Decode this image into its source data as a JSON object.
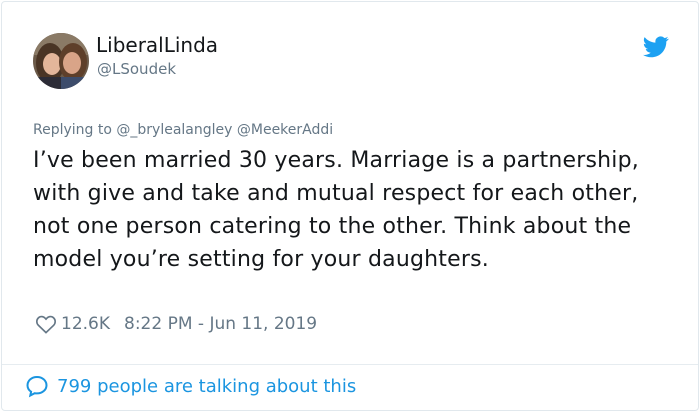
{
  "tweet": {
    "author": {
      "display_name": "LiberalLinda",
      "handle": "@LSoudek",
      "avatar_icon": "profile-photo"
    },
    "reply_to": {
      "prefix": "Replying to",
      "mentions": [
        "@_brylealangley",
        "@MeekerAddi"
      ]
    },
    "text": "I’ve been married 30 years. Marriage is a partnership, with give and take and mutual respect for each other, not one person catering to the other. Think about the model you’re setting for your daughters.",
    "likes": "12.6K",
    "timestamp": "8:22 PM - Jun 11, 2019",
    "conversation_label": "799 people are talking about this",
    "icons": {
      "brand": "twitter-bird-icon",
      "like": "heart-icon",
      "conversation": "speech-bubble-icon"
    },
    "colors": {
      "brand_blue": "#1da1f2",
      "link_blue": "#1b95e0",
      "text": "#14171a",
      "muted": "#657786"
    }
  }
}
